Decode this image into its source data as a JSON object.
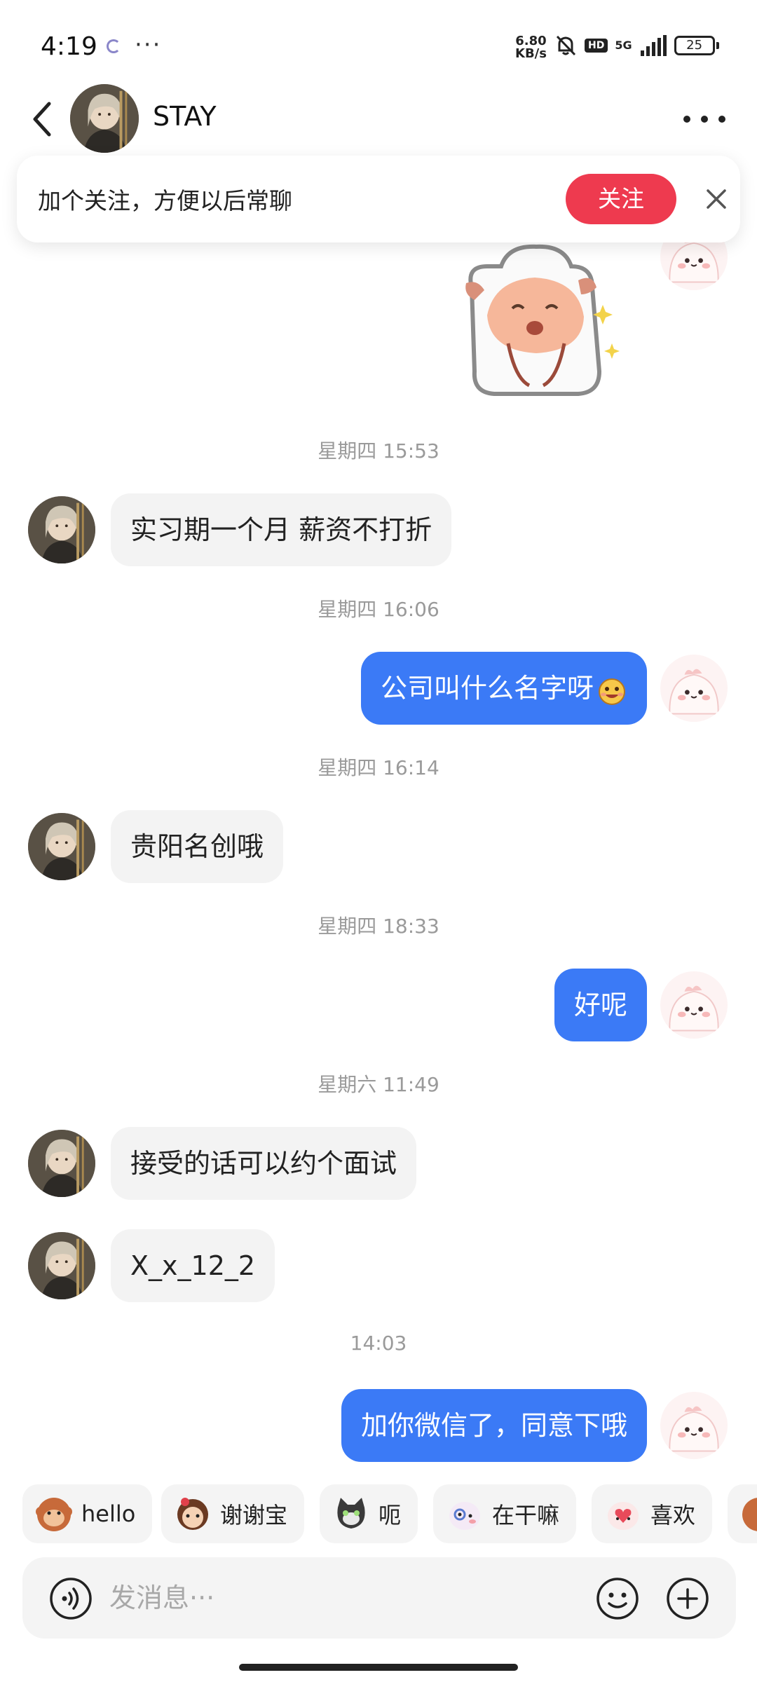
{
  "status_bar": {
    "time": "4:19",
    "dots": "···",
    "net_speed_value": "6.80",
    "net_speed_unit": "KB/s",
    "hd_badge": "HD",
    "network": "5G",
    "battery": "25"
  },
  "header": {
    "contact_name": "STAY"
  },
  "follow_banner": {
    "text": "加个关注，方便以后常聊",
    "follow_label": "关注"
  },
  "messages": {
    "ts1": "星期四 15:53",
    "in1": "实习期一个月 薪资不打折",
    "ts2": "星期四 16:06",
    "out1": "公司叫什么名字呀",
    "ts3": "星期四 16:14",
    "in2": "贵阳名创哦",
    "ts4": "星期四 18:33",
    "out2": "好呢",
    "ts5": "星期六 11:49",
    "in3": "接受的话可以约个面试",
    "in4": "X_x_12_2",
    "ts6": "14:03",
    "out3": "加你微信了，同意下哦"
  },
  "quick_replies": [
    {
      "label": "hello"
    },
    {
      "label": "谢谢宝"
    },
    {
      "label": "呃"
    },
    {
      "label": "在干嘛"
    },
    {
      "label": "喜欢"
    }
  ],
  "input_bar": {
    "placeholder": "发消息···"
  },
  "colors": {
    "accent_blue": "#3b7af6",
    "follow_red": "#ee3a4f",
    "bubble_gray": "#f3f3f3"
  },
  "icons": [
    "back-arrow-icon",
    "more-icon",
    "close-icon",
    "voice-icon",
    "emoji-icon",
    "plus-icon"
  ]
}
